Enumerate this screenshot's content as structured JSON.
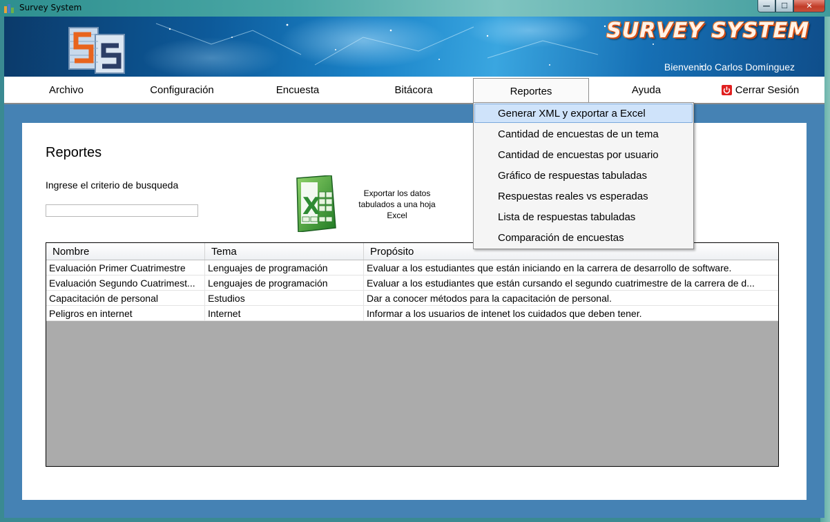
{
  "window": {
    "title": "Survey System",
    "buttons": {
      "minimize": "—",
      "maximize": "☐",
      "close": "✕"
    }
  },
  "banner": {
    "title": "SURVEY SYSTEM",
    "welcome": "Bienvenido Carlos Domínguez",
    "logo_text": "Survey System"
  },
  "menu": {
    "items": [
      "Archivo",
      "Configuración",
      "Encuesta",
      "Bitácora",
      "Reportes",
      "Ayuda"
    ],
    "logout": "Cerrar Sesión",
    "open_item": "Reportes"
  },
  "dropdown": {
    "items": [
      "Generar XML y exportar a Excel",
      "Cantidad de encuestas de un tema",
      "Cantidad de encuestas por usuario",
      "Gráfico de respuestas tabuladas",
      "Respuestas reales vs esperadas",
      "Lista de respuestas tabuladas",
      "Comparación de encuestas"
    ],
    "highlighted_index": 0
  },
  "page": {
    "title": "Reportes",
    "criteria_label": "Ingrese el criterio de busqueda",
    "search_value": "",
    "export_label": "Exportar los datos tabulados a una hoja Excel"
  },
  "grid": {
    "columns": [
      "Nombre",
      "Tema",
      "Propósito"
    ],
    "rows": [
      [
        "Evaluación Primer Cuatrimestre",
        "Lenguajes de programación",
        "Evaluar a los estudiantes que están iniciando en la carrera de desarrollo de software."
      ],
      [
        "Evaluación Segundo Cuatrimest...",
        "Lenguajes de programación",
        "Evaluar a los estudiantes que están cursando el segundo cuatrimestre de la carrera de d..."
      ],
      [
        "Capacitación de personal",
        "Estudios",
        "Dar a conocer métodos para la capacitación de personal."
      ],
      [
        "Peligros en internet",
        "Internet",
        "Informar a los usuarios de intenet los cuidados que deben tener."
      ]
    ]
  },
  "colors": {
    "frame_blue": "#4582b4",
    "grid_empty": "#ababab",
    "highlight": "#cfe3fa",
    "logout_red": "#e02020",
    "banner_accent": "#f07a2d"
  }
}
